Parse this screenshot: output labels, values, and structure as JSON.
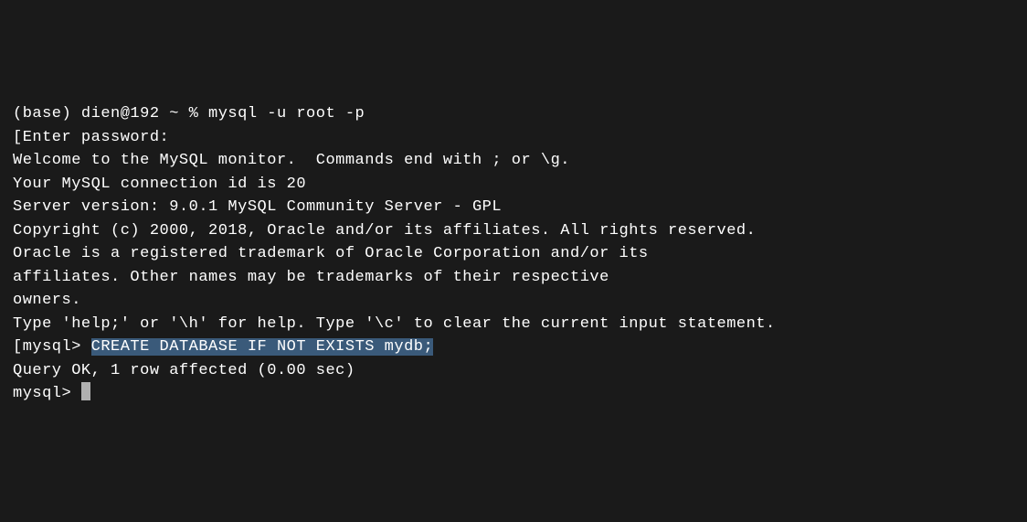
{
  "terminal": {
    "shell_prompt_line": "(base) dien@192 ~ % mysql -u root -p",
    "blank1": "",
    "enter_password_bracket": "[",
    "enter_password": "Enter password:",
    "welcome": "Welcome to the MySQL monitor.  Commands end with ; or \\g.",
    "connection_id": "Your MySQL connection id is 20",
    "server_version": "Server version: 9.0.1 MySQL Community Server - GPL",
    "blank2": "",
    "copyright": "Copyright (c) 2000, 2018, Oracle and/or its affiliates. All rights reserved.",
    "blank3": "",
    "trademark1": "Oracle is a registered trademark of Oracle Corporation and/or its",
    "trademark2": "affiliates. Other names may be trademarks of their respective",
    "trademark3": "owners.",
    "blank4": "",
    "help_line": "Type 'help;' or '\\h' for help. Type '\\c' to clear the current input statement.",
    "blank5": "",
    "mysql_prompt_bracket": "[",
    "mysql_prompt1": "mysql> ",
    "create_db_cmd": "CREATE DATABASE IF NOT EXISTS mydb;",
    "query_ok": "Query OK, 1 row affected (0.00 sec)",
    "blank6": "",
    "mysql_prompt2": "mysql> "
  }
}
